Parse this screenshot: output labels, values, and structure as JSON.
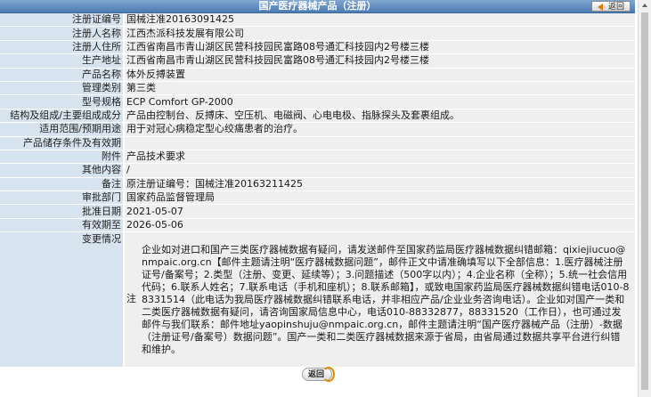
{
  "header": {
    "title": "国产医疗器械产品（注册）",
    "back_label": "返回"
  },
  "rows": [
    {
      "label": "注册证编号",
      "value": "国械注准20163091425"
    },
    {
      "label": "注册人名称",
      "value": "江西杰派科技发展有限公司"
    },
    {
      "label": "注册人住所",
      "value": "江西省南昌市青山湖区民营科技园民富路08号通汇科技园内2号楼三楼"
    },
    {
      "label": "生产地址",
      "value": "江西省南昌市青山湖区民营科技园民富路08号通汇科技园内2号楼三楼"
    },
    {
      "label": "产品名称",
      "value": "体外反搏装置"
    },
    {
      "label": "管理类别",
      "value": "第三类"
    },
    {
      "label": "型号规格",
      "value": "ECP Comfort GP-2000"
    },
    {
      "label": "结构及组成/主要组成成分",
      "value": "产品由控制台、反搏床、空压机、电磁阀、心电电极、指脉探头及套裹组成。"
    },
    {
      "label": "适用范围/预期用途",
      "value": "用于对冠心病稳定型心绞痛患者的治疗。"
    },
    {
      "label": "产品储存条件及有效期",
      "value": ""
    },
    {
      "label": "附件",
      "value": "产品技术要求"
    },
    {
      "label": "其他内容",
      "value": "/"
    },
    {
      "label": "备注",
      "value": "原注册证编号：国械注准20163211425"
    },
    {
      "label": "审批部门",
      "value": "国家药品监督管理局"
    },
    {
      "label": "批准日期",
      "value": "2021-05-07"
    },
    {
      "label": "有效期至",
      "value": "2026-05-06"
    }
  ],
  "change": {
    "label": "变更情况",
    "note_label": "注",
    "note_text": "企业如对进口和国产三类医疗器械数据有疑问，请发送邮件至国家药监局医疗器械数据纠错邮箱：qixiejiucuo@nmpaic.org.cn【邮件主题请注明“医疗器械数据问题”，邮件正文中请准确填写以下全部信息：1.医疗器械注册证号/备案号；2.类型（注册、变更、延续等）；3.问题描述（500字以内）；4.企业名称（全称）；5.统一社会信用代码；6.联系人姓名；7.联系电话（手机和座机）；8.联系邮箱】，或致电国家药监局医疗器械数据纠错电话010-88331514（此电话为我局医疗器械数据纠错联系电话，并非相应产品/企业业务咨询电话）。企业如对国产一类和二类医疗器械数据有疑问，请咨询国家局信息中心，电话010-88332877，88331520（工作日），也可通过发邮件与我们联系：邮件地址yaopinshuju@nmpaic.org.cn，邮件主题请注明“国产医疗器械产品（注册）-数据（注册证号/备案号）数据问题”。国产一类和二类医疗器械数据来源于省局，由省局通过数据共享平台进行纠错和维护。"
  },
  "footer": {
    "back_label": "返回"
  },
  "colors": {
    "header_bg": "#5d8bbf",
    "label_bg": "#d7e3ee",
    "value_bg": "#efefef",
    "accent": "#e07b00"
  }
}
